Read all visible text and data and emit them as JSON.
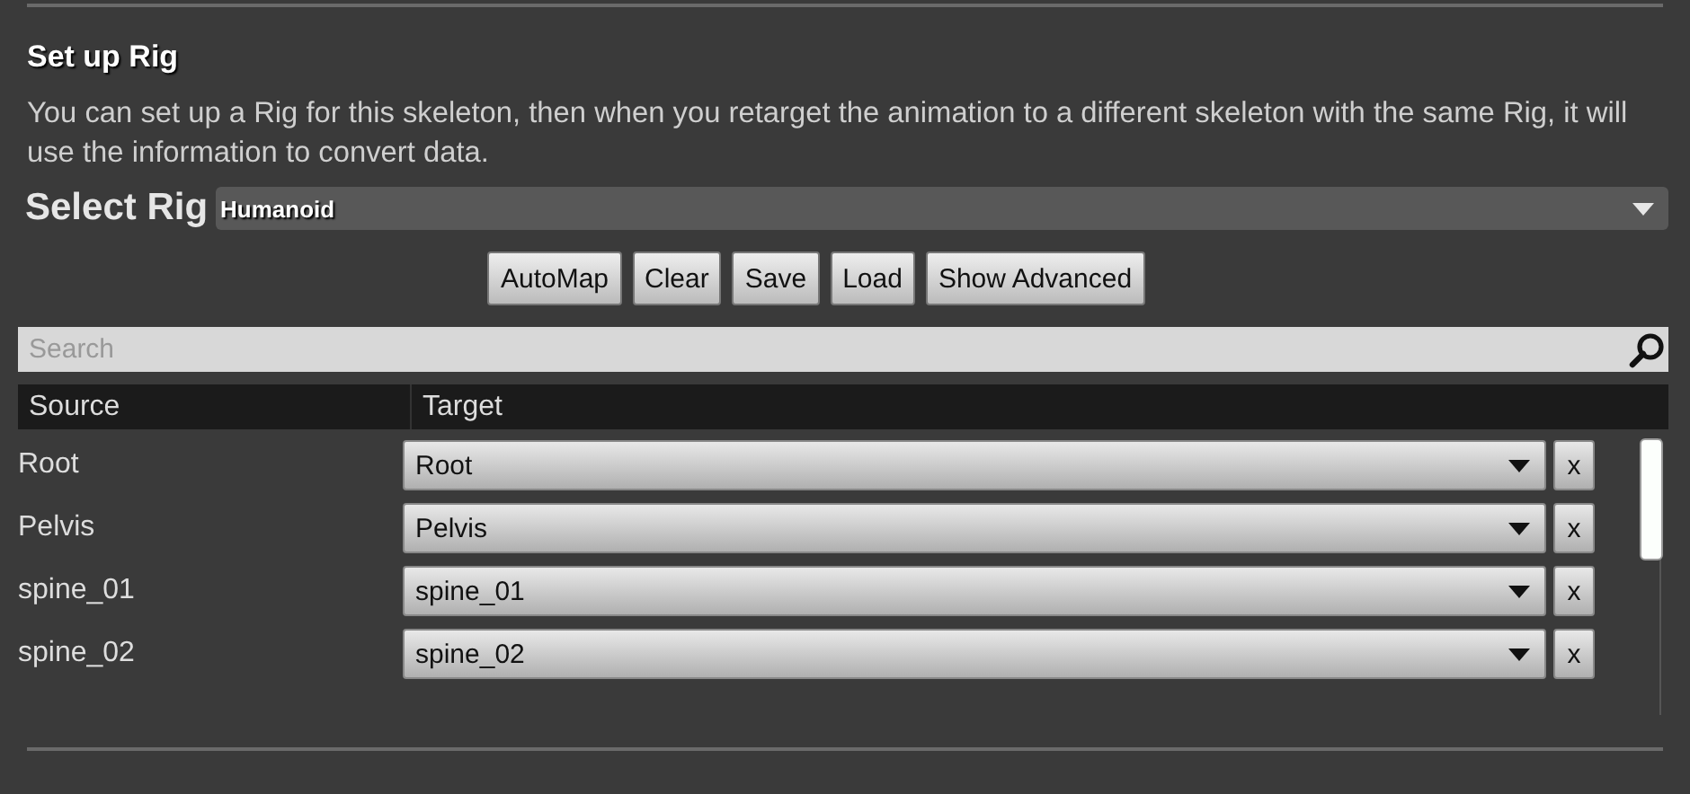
{
  "section": {
    "title": "Set up Rig",
    "description": "You can set up a Rig for this skeleton, then when you retarget the animation to a different skeleton with the same Rig, it will use the information to convert data."
  },
  "rig_select": {
    "label": "Select Rig",
    "value": "Humanoid"
  },
  "buttons": [
    "AutoMap",
    "Clear",
    "Save",
    "Load",
    "Show Advanced"
  ],
  "search": {
    "placeholder": "Search"
  },
  "table": {
    "columns": [
      "Source",
      "Target"
    ],
    "rows": [
      {
        "source": "Root",
        "target": "Root",
        "clear": "x"
      },
      {
        "source": "Pelvis",
        "target": "Pelvis",
        "clear": "x"
      },
      {
        "source": "spine_01",
        "target": "spine_01",
        "clear": "x"
      },
      {
        "source": "spine_02",
        "target": "spine_02",
        "clear": "x"
      }
    ]
  }
}
